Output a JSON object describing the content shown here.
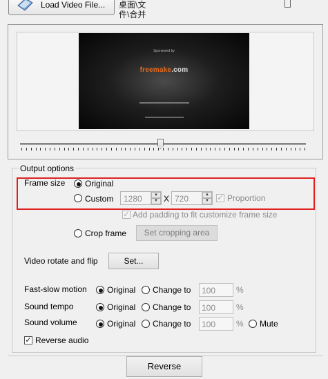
{
  "toolbar": {
    "load_video_label": "Load Video File...",
    "path_lines": [
      "桌面\\文",
      "件\\合并"
    ]
  },
  "preview": {
    "sponsored_by": "Sponsored by",
    "logo_main": "freemake",
    "logo_suffix": ".com"
  },
  "output_options": {
    "title": "Output options",
    "frame_size": {
      "label": "Frame size",
      "original_label": "Original",
      "original_selected": true,
      "custom_label": "Custom",
      "width_value": "1280",
      "x_label": "X",
      "height_value": "720",
      "proportion_label": "Proportion",
      "proportion_checked": true,
      "add_padding_label": "Add padding to fit customize frame size",
      "add_padding_checked": true
    },
    "crop": {
      "label": "Crop frame",
      "button_label": "Set cropping area"
    },
    "rotate": {
      "label": "Video rotate and flip",
      "button_label": "Set..."
    },
    "fast_slow": {
      "label": "Fast-slow motion",
      "original_label": "Original",
      "change_label": "Change to",
      "value": "100",
      "unit": "%"
    },
    "sound_tempo": {
      "label": "Sound tempo",
      "original_label": "Original",
      "change_label": "Change to",
      "value": "100",
      "unit": "%"
    },
    "sound_volume": {
      "label": "Sound volume",
      "original_label": "Original",
      "change_label": "Change to",
      "value": "100",
      "unit": "%",
      "mute_label": "Mute"
    },
    "reverse_audio": {
      "label": "Reverse audio",
      "checked": true
    }
  },
  "footer": {
    "reverse_button_label": "Reverse"
  },
  "colors": {
    "highlight_border": "#e02020",
    "logo_orange": "#e86a1a"
  },
  "slider": {
    "position_fraction": 0.49
  }
}
